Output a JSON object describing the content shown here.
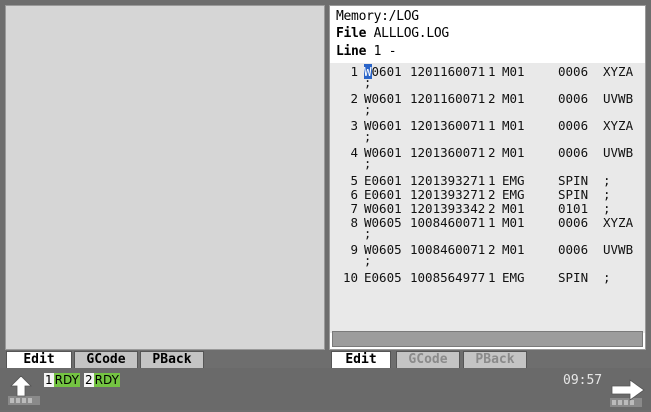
{
  "editor": {
    "memory_path": "Memory:/LOG",
    "file_label": "File",
    "file_name": "ALLLOG.LOG",
    "line_label": "Line",
    "line_value": "1 -",
    "lines": [
      {
        "num": "1",
        "code_first": "W",
        "code_rest": "0601",
        "ts": "1201160071",
        "ch": "1",
        "cat": "M01",
        "val": "0006",
        "axis": "XYZA",
        "cont": ";"
      },
      {
        "num": "2",
        "code_first": "W",
        "code_rest": "0601",
        "ts": "1201160071",
        "ch": "2",
        "cat": "M01",
        "val": "0006",
        "axis": "UVWB",
        "cont": ";"
      },
      {
        "num": "3",
        "code_first": "W",
        "code_rest": "0601",
        "ts": "1201360071",
        "ch": "1",
        "cat": "M01",
        "val": "0006",
        "axis": "XYZA",
        "cont": ";"
      },
      {
        "num": "4",
        "code_first": "W",
        "code_rest": "0601",
        "ts": "1201360071",
        "ch": "2",
        "cat": "M01",
        "val": "0006",
        "axis": "UVWB",
        "cont": ";"
      },
      {
        "num": "5",
        "code_first": "E",
        "code_rest": "0601",
        "ts": "1201393271",
        "ch": "1",
        "cat": "EMG",
        "val": "SPIN",
        "axis": ";",
        "cont": ""
      },
      {
        "num": "6",
        "code_first": "E",
        "code_rest": "0601",
        "ts": "1201393271",
        "ch": "2",
        "cat": "EMG",
        "val": "SPIN",
        "axis": ";",
        "cont": ""
      },
      {
        "num": "7",
        "code_first": "W",
        "code_rest": "0601",
        "ts": "1201393342",
        "ch": "2",
        "cat": "M01",
        "val": "0101",
        "axis": ";",
        "cont": ""
      },
      {
        "num": "8",
        "code_first": "W",
        "code_rest": "0605",
        "ts": "1008460071",
        "ch": "1",
        "cat": "M01",
        "val": "0006",
        "axis": "XYZA",
        "cont": ";"
      },
      {
        "num": "9",
        "code_first": "W",
        "code_rest": "0605",
        "ts": "1008460071",
        "ch": "2",
        "cat": "M01",
        "val": "0006",
        "axis": "UVWB",
        "cont": ";"
      },
      {
        "num": "10",
        "code_first": "E",
        "code_rest": "0605",
        "ts": "1008564977",
        "ch": "1",
        "cat": "EMG",
        "val": "SPIN",
        "axis": ";",
        "cont": ""
      }
    ]
  },
  "left_tabs": [
    "Edit",
    "GCode",
    "PBack"
  ],
  "right_tabs": [
    "Edit",
    "GCode",
    "PBack"
  ],
  "status": {
    "ch1_num": "1",
    "ch1_txt": "RDY",
    "ch2_num": "2",
    "ch2_txt": "RDY",
    "clock": "09:57"
  },
  "icons": {
    "left_arrow": "up-return-arrow-icon",
    "right_arrow": "right-arrow-icon"
  },
  "colors": {
    "ready_green": "#74c442",
    "cursor_blue": "#2a64c8",
    "panel_gray": "#d6d6d6",
    "status_gray": "#6a6a6a"
  }
}
